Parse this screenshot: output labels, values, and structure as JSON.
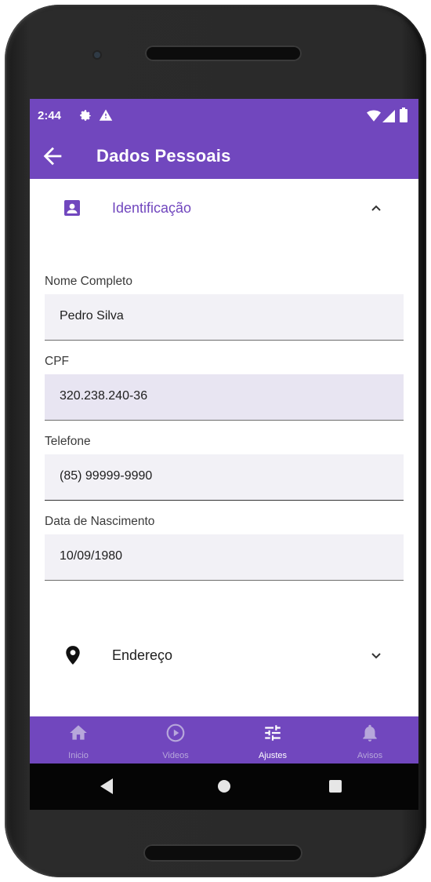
{
  "status_bar": {
    "time": "2:44",
    "icons": [
      "settings-icon",
      "alert-icon",
      "wifi-icon",
      "signal-icon",
      "battery-icon"
    ]
  },
  "app_bar": {
    "back_icon": "arrow-back-icon",
    "title": "Dados Pessoais"
  },
  "sections": {
    "identificacao": {
      "label": "Identificação",
      "icon": "person-badge-icon",
      "expanded": true,
      "fields": [
        {
          "label": "Nome Completo",
          "value": "Pedro Silva"
        },
        {
          "label": "CPF",
          "value": "320.238.240-36"
        },
        {
          "label": "Telefone",
          "value": "(85) 99999-9990"
        },
        {
          "label": "Data de Nascimento",
          "value": "10/09/1980"
        }
      ]
    },
    "endereco": {
      "label": "Endereço",
      "icon": "location-pin-icon",
      "expanded": false
    }
  },
  "bottom_nav": {
    "items": [
      {
        "label": "Inicio",
        "icon": "home-icon",
        "active": false
      },
      {
        "label": "Videos",
        "icon": "play-circle-icon",
        "active": false
      },
      {
        "label": "Ajustes",
        "icon": "sliders-icon",
        "active": true
      },
      {
        "label": "Avisos",
        "icon": "bell-icon",
        "active": false
      }
    ]
  },
  "colors": {
    "primary": "#7147be",
    "accent_text": "#7147be",
    "field_bg_default": "#f2f1f6",
    "field_bg_focused": "#e8e5f2",
    "nav_inactive": "#b7a7db",
    "nav_active": "#ffffff"
  }
}
